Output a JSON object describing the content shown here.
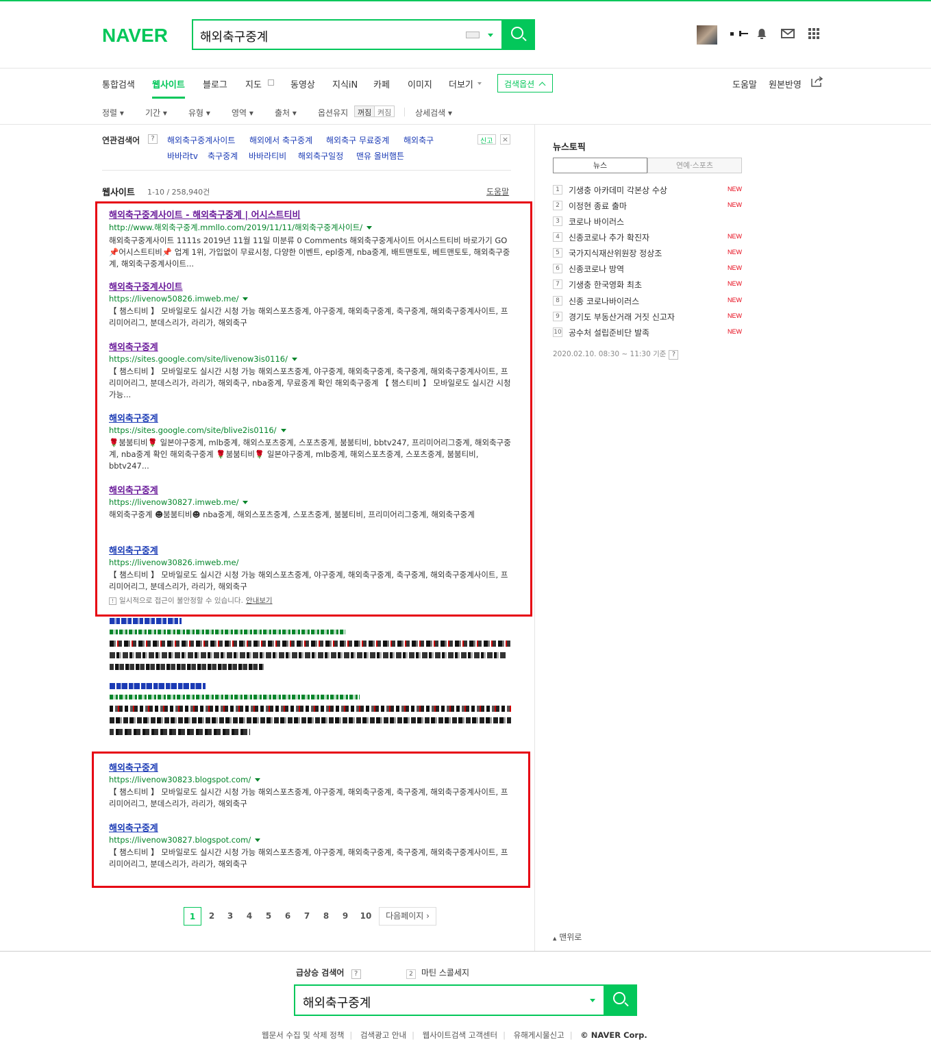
{
  "header": {
    "logo": "NAVER",
    "query": "해외축구중계"
  },
  "tabs": [
    {
      "label": "통합검색"
    },
    {
      "label": "웹사이트"
    },
    {
      "label": "블로그"
    },
    {
      "label": "지도"
    },
    {
      "label": "동영상"
    },
    {
      "label": "지식iN"
    },
    {
      "label": "카페"
    },
    {
      "label": "이미지"
    },
    {
      "label": "더보기"
    }
  ],
  "search_options_label": "검색옵션",
  "tabs_right": {
    "help": "도움말",
    "original": "원본반영"
  },
  "filters": {
    "sort": "정렬",
    "period": "기간",
    "type": "유형",
    "area": "영역",
    "source": "출처",
    "keep": "옵션유지",
    "keep_off": "꺼짐",
    "keep_on": "켜짐",
    "detail": "상세검색"
  },
  "related": {
    "label": "연관검색어",
    "help": "?",
    "report": "신고",
    "close": "×",
    "items": [
      "해외축구중계사이트",
      "해외에서 축구중계",
      "해외축구 무료중계",
      "해외축구",
      "바바라tv",
      "축구중계",
      "바바라티비",
      "해외축구일정",
      "맨유 올버햄튼"
    ]
  },
  "section": {
    "title": "웹사이트",
    "count": "1-10 / 258,940건",
    "help": "도움말"
  },
  "results": [
    {
      "title": "해외축구중계사이트 - 해외축구중계 | 어시스트티비",
      "url": "http://www.해외축구중계.mmllo.com/2019/11/11/해외축구중계사이트/",
      "desc": "해외축구중계사이트 1111s 2019년 11월 11일 미분류 0 Comments 해외축구중계사이트 어시스트티비 바로가기 GO 📌어시스트티비📌 업계 1위, 가입없이 무료시청, 다양한 이벤트, epl중계, nba중계, 배트맨토토, 베트맨토토, 해외축구중계, 해외축구중계사이트..."
    },
    {
      "title": "해외축구중계사이트",
      "url": "https://livenow50826.imweb.me/",
      "desc": "【 챔스티비 】 모바일로도 실시간 시청 가능 해외스포츠중계, 야구중계, 해외축구중계, 축구중계, 해외축구중계사이트, 프리미어리그, 분데스리가, 라리가, 해외축구"
    },
    {
      "title": "해외축구중계",
      "url": "https://sites.google.com/site/livenow3is0116/",
      "desc": "【 챔스티비 】 모바일로도 실시간 시청 가능 해외스포츠중계, 야구중계, 해외축구중계, 축구중계, 해외축구중계사이트, 프리미어리그, 분데스리가, 라리가, 해외축구, nba중계, 무료중계 확인 해외축구중계 【 챔스티비 】 모바일로도 실시간 시청 가능..."
    },
    {
      "title": "해외축구중계",
      "url": "https://sites.google.com/site/blive2is0116/",
      "desc": "🌹붐붐티비🌹 일본야구중계, mlb중계, 해외스포츠중계, 스포츠중계, 붐붐티비, bbtv247, 프리미어리그중계, 해외축구중계, nba중계 확인 해외축구중계 🌹붐붐티비🌹 일본야구중계, mlb중계, 해외스포츠중계, 스포츠중계, 붐붐티비, bbtv247..."
    },
    {
      "title": "해외축구중계",
      "url": "https://livenow30827.imweb.me/",
      "desc": "해외축구중계 ☻붐붐티비☻ nba중계, 해외스포츠중계, 스포츠중계, 붐붐티비, 프리미어리그중계, 해외축구중계"
    },
    {
      "title": "해외축구중계",
      "url": "https://livenow30826.imweb.me/",
      "desc": "【 챔스티비 】 모바일로도 실시간 시청 가능 해외스포츠중계, 야구중계, 해외축구중계, 축구중계, 해외축구중계사이트, 프리미어리그, 분데스리가, 라리가, 해외축구",
      "note": "일시적으로 접근이 불안정할 수 있습니다.",
      "note_link": "안내보기"
    },
    {
      "title": "해외축구중계",
      "url": "https://livenow30823.blogspot.com/",
      "desc": "【 챔스티비 】 모바일로도 실시간 시청 가능 해외스포츠중계, 야구중계, 해외축구중계, 축구중계, 해외축구중계사이트, 프리미어리그, 분데스리가, 라리가, 해외축구"
    },
    {
      "title": "해외축구중계",
      "url": "https://livenow30827.blogspot.com/",
      "desc": "【 챔스티비 】 모바일로도 실시간 시청 가능 해외스포츠중계, 야구중계, 해외축구중계, 축구중계, 해외축구중계사이트, 프리미어리그, 분데스리가, 라리가, 해외축구"
    }
  ],
  "pager": {
    "pages": [
      "1",
      "2",
      "3",
      "4",
      "5",
      "6",
      "7",
      "8",
      "9",
      "10"
    ],
    "next": "다음페이지"
  },
  "news": {
    "title": "뉴스토픽",
    "tab_news": "뉴스",
    "tab_ent": "연예·스포츠",
    "new_label": "NEW",
    "items": [
      {
        "rank": "1",
        "title": "기생충 아카데미 각본상 수상",
        "new": true
      },
      {
        "rank": "2",
        "title": "이정현 종료 출마",
        "new": true
      },
      {
        "rank": "3",
        "title": "코로나 바이러스",
        "new": false
      },
      {
        "rank": "4",
        "title": "신종코로나 추가 확진자",
        "new": true
      },
      {
        "rank": "5",
        "title": "국가지식재산위원장 정상조",
        "new": true
      },
      {
        "rank": "6",
        "title": "신종코로나 방역",
        "new": true
      },
      {
        "rank": "7",
        "title": "기생충 한국영화 최초",
        "new": true
      },
      {
        "rank": "8",
        "title": "신종 코로나바이러스",
        "new": true
      },
      {
        "rank": "9",
        "title": "경기도 부동산거래 거짓 신고자",
        "new": true
      },
      {
        "rank": "10",
        "title": "공수처 설립준비단 발족",
        "new": true
      }
    ],
    "time": "2020.02.10. 08:30 ~ 11:30 기준",
    "help": "?"
  },
  "totop": "맨위로",
  "footer": {
    "rising_label": "급상승 검색어",
    "rising_help": "?",
    "rising_rank": "2",
    "rising_item": "마틴 스콜세지",
    "query": "해외축구중계",
    "links": [
      "웹문서 수집 및 삭제 정책",
      "검색광고 안내",
      "웹사이트검색 고객센터",
      "유해게시물신고"
    ],
    "corp": "© NAVER Corp."
  },
  "colors": {
    "brand": "#03c75a",
    "highlight_box": "#e60012",
    "link": "#1b3bb5",
    "url": "#03852a"
  }
}
